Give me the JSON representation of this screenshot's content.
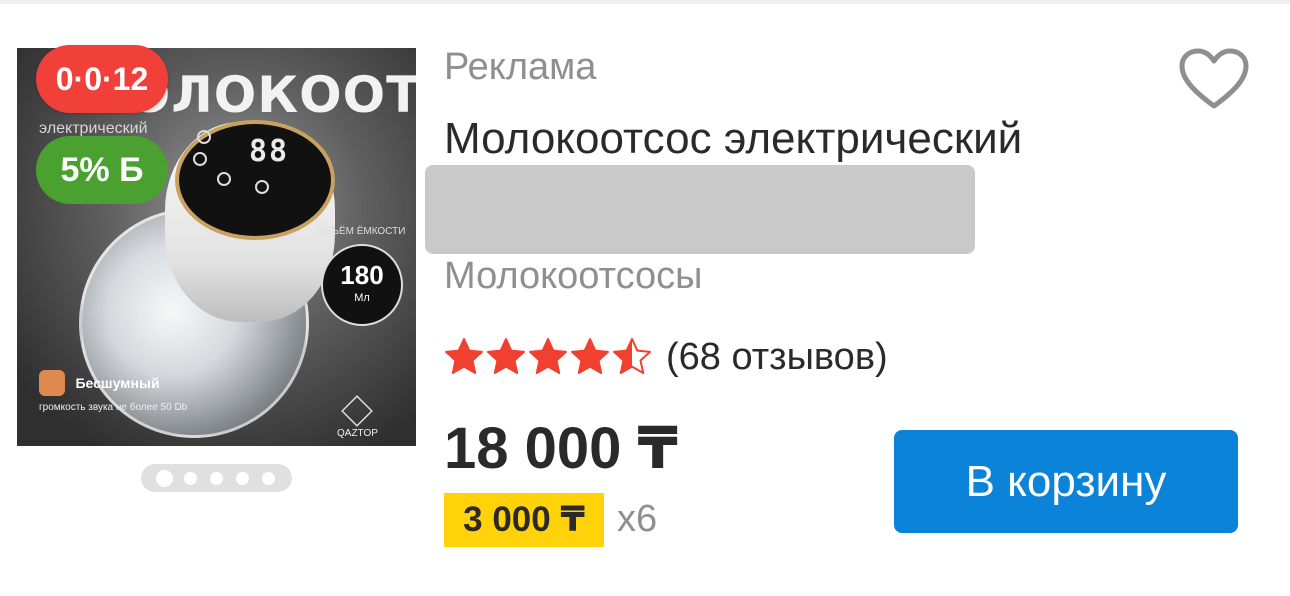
{
  "product_image": {
    "title": "МОЛОКООТСОС",
    "subtitle": "электрический",
    "display_digits": "88",
    "volume_caption": "ОБЪЁМ ЁМКОСТИ",
    "volume_value": "180",
    "volume_unit": "Мл",
    "noise_title": "Бесшумный",
    "noise_desc": "громкость звука не более 50 Db",
    "brand": "QAZTOP"
  },
  "badges": {
    "installment": "0·0·12",
    "bonus": "5% Б"
  },
  "carousel": {
    "total": 5,
    "active": 1
  },
  "ad_label": "Реклама",
  "title": "Молокоотсос электрический",
  "category": "Молокоотсосы",
  "rating": {
    "stars": 4.5,
    "reviews": "(68 отзывов)"
  },
  "price": "18 000 ₸",
  "installment": {
    "amount": "3 000 ₸",
    "multiplier": "x6"
  },
  "cart_button": "В корзину",
  "icons": {
    "favorite": "heart-outline-icon",
    "rating": "star-icon"
  },
  "colors": {
    "accent_blue": "#0a83d8",
    "installment_red": "#f13f3a",
    "bonus_green": "#4aa12f",
    "installment_yellow": "#ffd20a",
    "star_red": "#f0402f"
  }
}
